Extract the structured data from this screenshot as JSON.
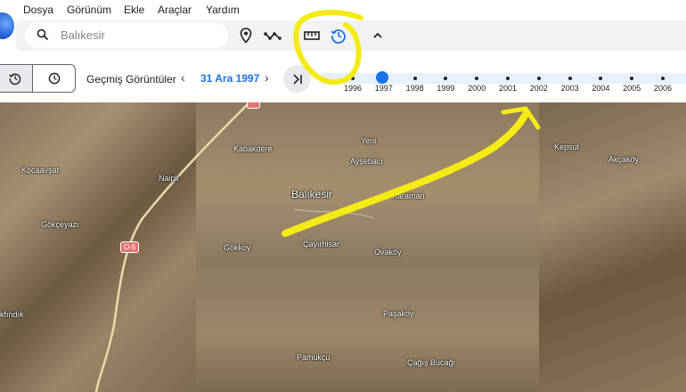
{
  "menu": [
    "Dosya",
    "Görünüm",
    "Ekle",
    "Araçlar",
    "Yardım"
  ],
  "search": {
    "placeholder": "Balıkesir"
  },
  "toolbar_icons": [
    "pin-icon",
    "path-icon",
    "ruler-icon",
    "history-icon",
    "chevron-up-icon"
  ],
  "history_bar": {
    "label": "Geçmiş Görüntüler",
    "date": "31 Ara 1997",
    "prev": "‹",
    "next": "›",
    "years": [
      "1996",
      "1997",
      "1998",
      "1999",
      "2000",
      "2001",
      "2002",
      "2003",
      "2004",
      "2005",
      "2006"
    ],
    "selected_year": "1997"
  },
  "map": {
    "places": [
      "Kabakdere",
      "Yeni",
      "Ayşebacı",
      "Balıkesir",
      "Karaman",
      "Gökköy",
      "Çayırhisar",
      "Ovaköy",
      "Paşaköy",
      "Pamukçu",
      "Çağış Bucağı",
      "Kocaavşar",
      "Naipli",
      "Gökçeyazı",
      "kfındık",
      "Kepsut",
      "Akçaköy"
    ],
    "road_badges": [
      "O-5"
    ]
  },
  "colors": {
    "accent": "#1a73e8",
    "annotation": "#f5ea14"
  }
}
